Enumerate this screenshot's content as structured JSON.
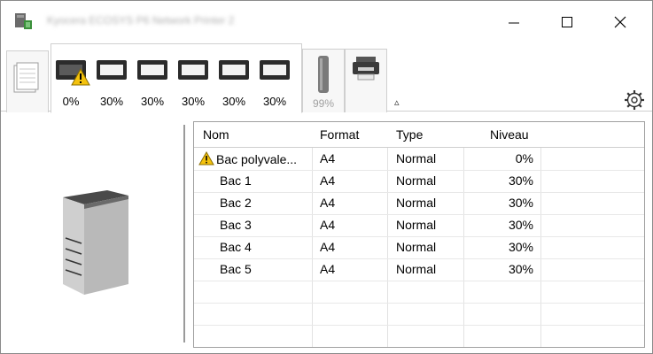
{
  "window": {
    "title_blurred": "Kyocera ECOSYS P6 Network Printer 2",
    "controls": {
      "minimize": "–",
      "maximize": "☐",
      "close": "×"
    }
  },
  "trays_tab": {
    "trays": [
      {
        "name": "Bac polyvalent",
        "percent": "0%",
        "warning": true
      },
      {
        "name": "Bac 1",
        "percent": "30%",
        "warning": false
      },
      {
        "name": "Bac 2",
        "percent": "30%",
        "warning": false
      },
      {
        "name": "Bac 3",
        "percent": "30%",
        "warning": false
      },
      {
        "name": "Bac 4",
        "percent": "30%",
        "warning": false
      },
      {
        "name": "Bac 5",
        "percent": "30%",
        "warning": false
      }
    ]
  },
  "toner_tab": {
    "percent": "99%"
  },
  "collapse_caret": "▵",
  "grid": {
    "headers": {
      "name": "Nom",
      "format": "Format",
      "type": "Type",
      "level": "Niveau"
    },
    "rows": [
      {
        "name": "Bac polyvale...",
        "format": "A4",
        "type": "Normal",
        "level": "0%",
        "warning": true
      },
      {
        "name": "Bac 1",
        "format": "A4",
        "type": "Normal",
        "level": "30%",
        "warning": false
      },
      {
        "name": "Bac 2",
        "format": "A4",
        "type": "Normal",
        "level": "30%",
        "warning": false
      },
      {
        "name": "Bac 3",
        "format": "A4",
        "type": "Normal",
        "level": "30%",
        "warning": false
      },
      {
        "name": "Bac 4",
        "format": "A4",
        "type": "Normal",
        "level": "30%",
        "warning": false
      },
      {
        "name": "Bac 5",
        "format": "A4",
        "type": "Normal",
        "level": "30%",
        "warning": false
      }
    ]
  },
  "colors": {
    "warning": "#f4c20d",
    "border": "#a0a0a0",
    "tray_dark": "#2b2b2b"
  }
}
